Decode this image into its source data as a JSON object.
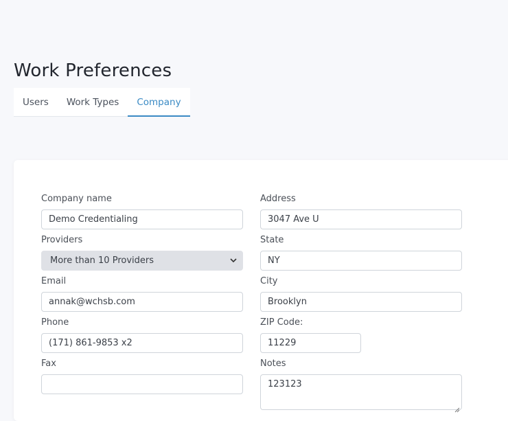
{
  "page": {
    "title": "Work Preferences"
  },
  "tabs": [
    {
      "label": "Users"
    },
    {
      "label": "Work Types"
    },
    {
      "label": "Company"
    }
  ],
  "active_tab": "Company",
  "form": {
    "company_name": {
      "label": "Company name",
      "value": "Demo Credentialing"
    },
    "providers": {
      "label": "Providers",
      "value": "More than 10 Providers"
    },
    "email": {
      "label": "Email",
      "value": "annak@wchsb.com"
    },
    "phone": {
      "label": "Phone",
      "value": "(171) 861-9853 x2"
    },
    "fax": {
      "label": "Fax",
      "value": ""
    },
    "address": {
      "label": "Address",
      "value": "3047 Ave U"
    },
    "state": {
      "label": "State",
      "value": "NY"
    },
    "city": {
      "label": "City",
      "value": "Brooklyn"
    },
    "zip": {
      "label": "ZIP Code:",
      "value": "11229"
    },
    "notes": {
      "label": "Notes",
      "value": "123123"
    }
  },
  "colors": {
    "accent": "#3a8ac4",
    "background": "#f7f8fb",
    "select_bg": "#dfe1e6"
  },
  "icons": {
    "select_arrow": "chevron-down-icon",
    "resize_handle": "resize-handle-icon"
  }
}
